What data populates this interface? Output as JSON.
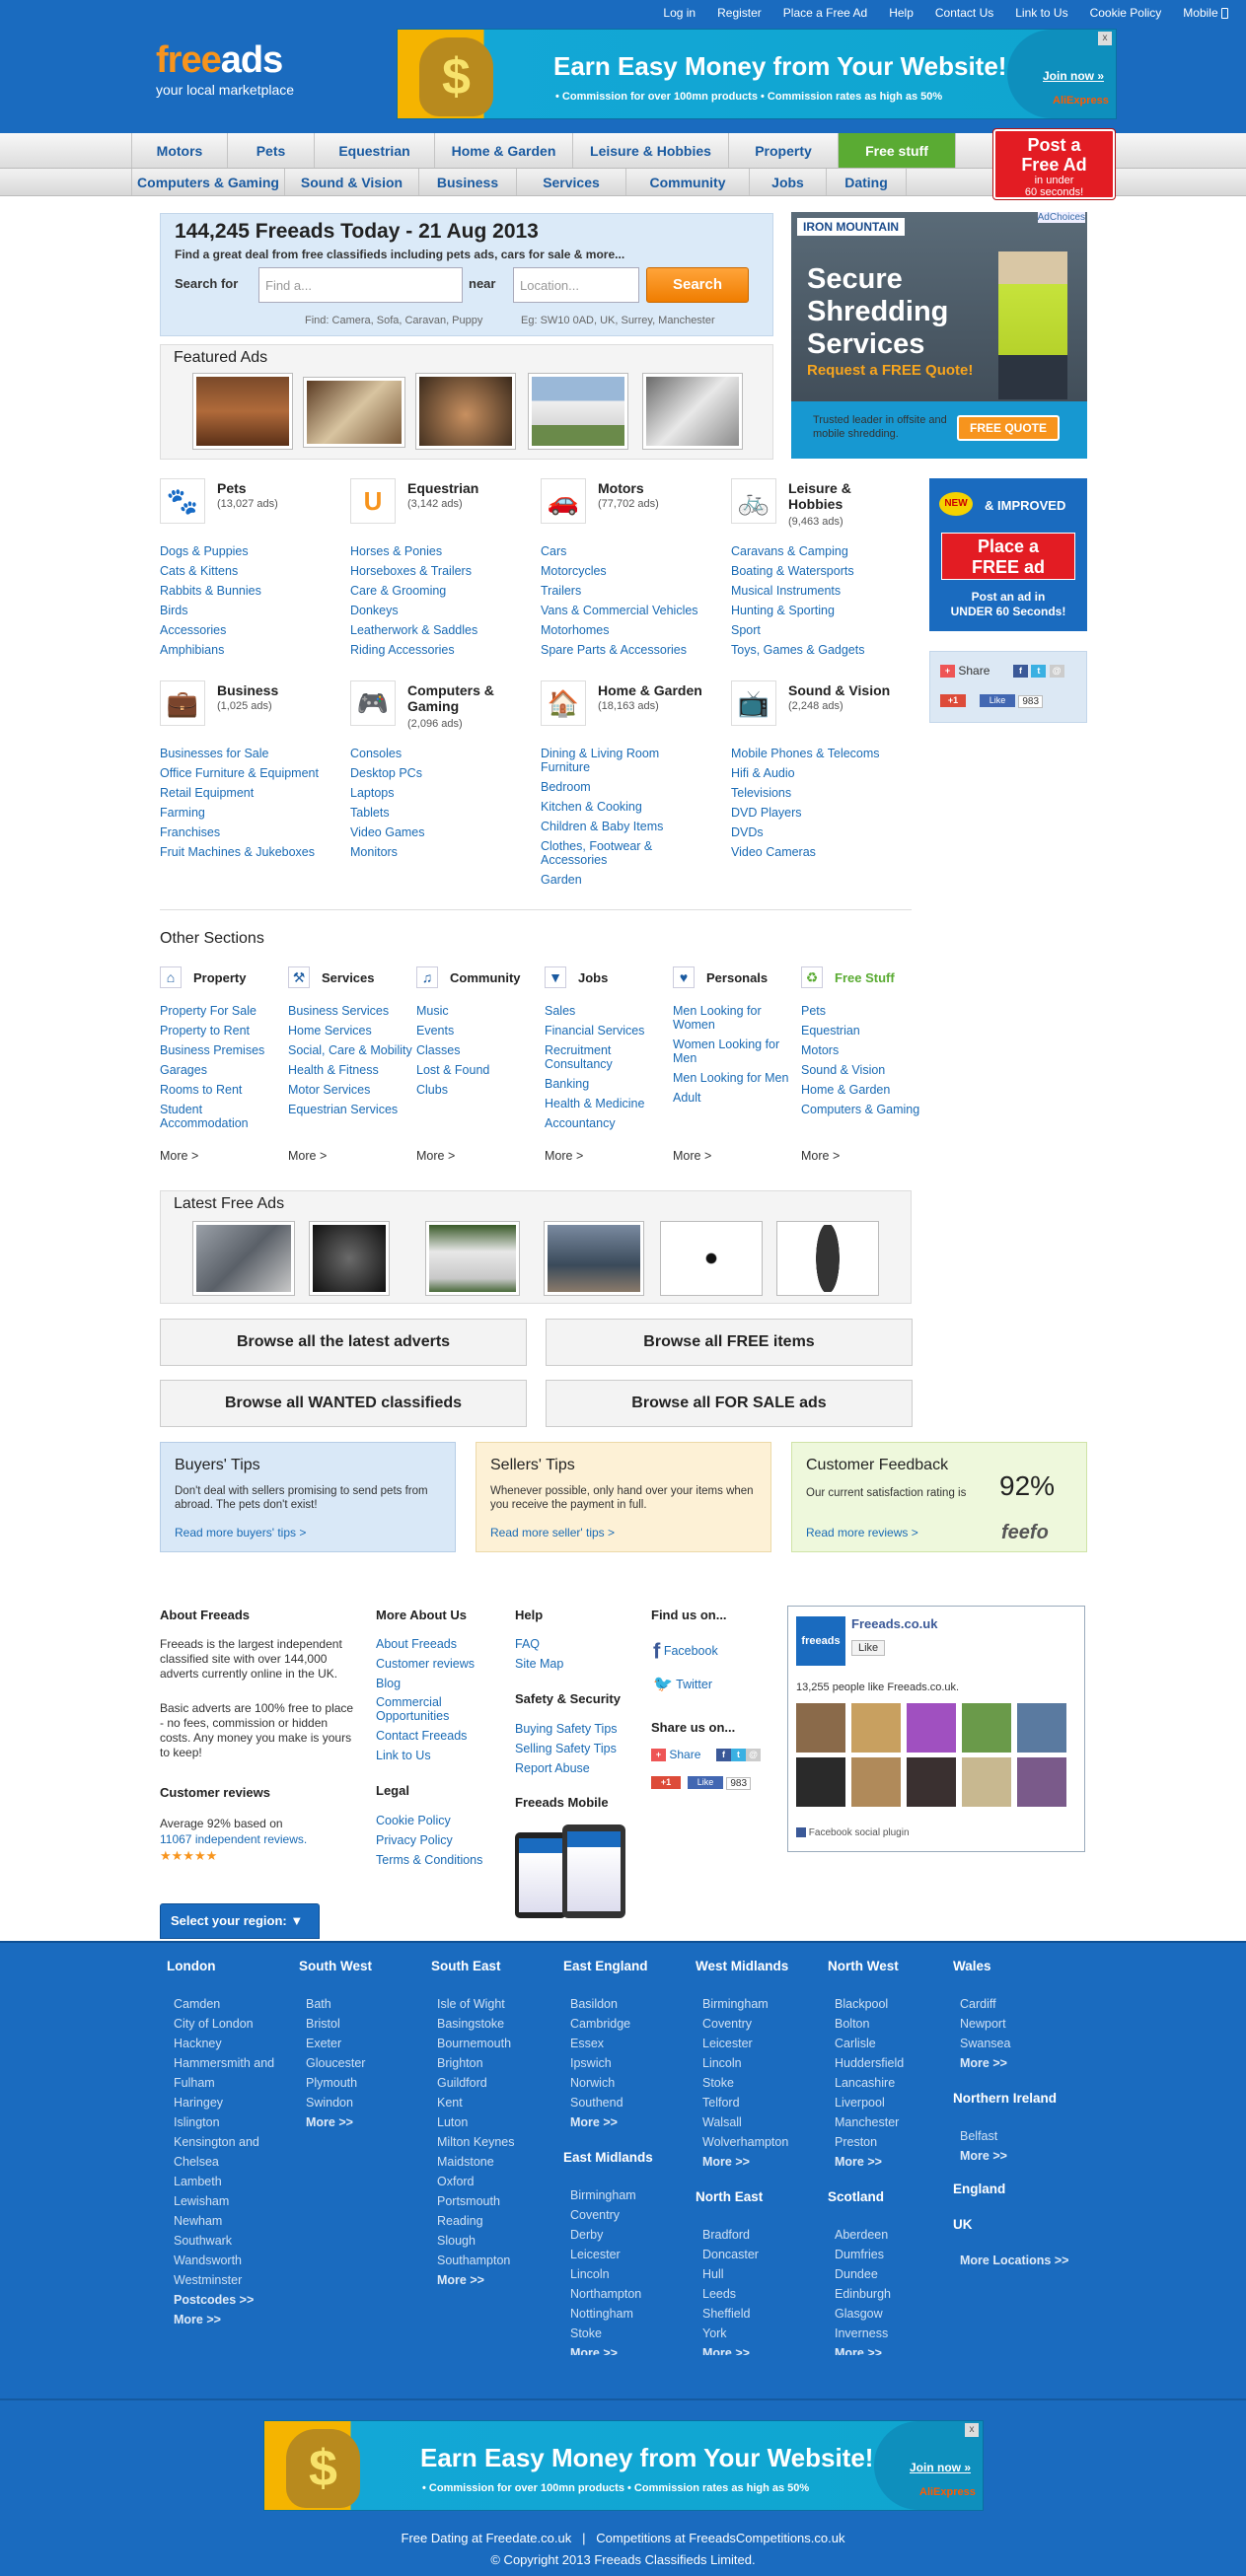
{
  "top_links": [
    "Log in",
    "Register",
    "Place a Free Ad",
    "Help",
    "Contact Us",
    "Link to Us",
    "Cookie Policy",
    "Mobile"
  ],
  "logo": {
    "part1": "free",
    "part2": "ads",
    "tagline": "your local marketplace"
  },
  "banner": {
    "title": "Earn Easy Money from Your Website!",
    "sub": "• Commission for over 100mn products • Commission rates as high as 50%",
    "join": "Join now »",
    "close": "x",
    "brand": "AliExpress"
  },
  "nav_primary": [
    "Motors",
    "Pets",
    "Equestrian",
    "Home & Garden",
    "Leisure & Hobbies",
    "Property",
    "Free stuff"
  ],
  "nav_secondary": [
    "Computers & Gaming",
    "Sound & Vision",
    "Business",
    "Services",
    "Community",
    "Jobs",
    "Dating"
  ],
  "post_ad": {
    "line1": "Post a",
    "line2": "Free Ad",
    "line3": "in under",
    "line4": "60 seconds!"
  },
  "search": {
    "title": "144,245 Freeads Today - 21 Aug 2013",
    "subtitle": "Find a great deal from free classifieds including pets ads, cars for sale & more...",
    "search_for": "Search for",
    "placeholder_what": "Find a...",
    "near": "near",
    "placeholder_where": "Location...",
    "button": "Search",
    "hint_find": "Find: Camera, Sofa, Caravan, Puppy",
    "hint_eg": "Eg: SW10 0AD, UK, Surrey, Manchester"
  },
  "featured": {
    "title": "Featured Ads"
  },
  "side_ad": {
    "brand": "IRON MOUNTAIN",
    "adchoices": "AdChoices",
    "headline1": "Secure",
    "headline2": "Shredding",
    "headline3": "Services",
    "cta": "Request a FREE Quote!",
    "footer": "Trusted leader in offsite and mobile shredding.",
    "button": "FREE QUOTE"
  },
  "categories": [
    {
      "title": "Pets",
      "count": "(13,027 ads)",
      "items": [
        "Dogs & Puppies",
        "Cats & Kittens",
        "Rabbits & Bunnies",
        "Birds",
        "Accessories",
        "Amphibians"
      ]
    },
    {
      "title": "Equestrian",
      "count": "(3,142 ads)",
      "items": [
        "Horses & Ponies",
        "Horseboxes & Trailers",
        "Care & Grooming",
        "Donkeys",
        "Leatherwork & Saddles",
        "Riding Accessories"
      ]
    },
    {
      "title": "Motors",
      "count": "(77,702 ads)",
      "items": [
        "Cars",
        "Motorcycles",
        "Trailers",
        "Vans & Commercial Vehicles",
        "Motorhomes",
        "Spare Parts & Accessories"
      ]
    },
    {
      "title": "Leisure & Hobbies",
      "count": "(9,463 ads)",
      "items": [
        "Caravans & Camping",
        "Boating & Watersports",
        "Musical Instruments",
        "Hunting & Sporting",
        "Sport",
        "Toys, Games & Gadgets"
      ]
    },
    {
      "title": "Business",
      "count": "(1,025 ads)",
      "items": [
        "Businesses for Sale",
        "Office Furniture & Equipment",
        "Retail Equipment",
        "Farming",
        "Franchises",
        "Fruit Machines & Jukeboxes"
      ]
    },
    {
      "title": "Computers & Gaming",
      "count": "(2,096 ads)",
      "items": [
        "Consoles",
        "Desktop PCs",
        "Laptops",
        "Tablets",
        "Video Games",
        "Monitors"
      ]
    },
    {
      "title": "Home & Garden",
      "count": "(18,163 ads)",
      "items": [
        "Dining & Living Room Furniture",
        "Bedroom",
        "Kitchen & Cooking",
        "Children & Baby Items",
        "Clothes, Footwear & Accessories",
        "Garden"
      ]
    },
    {
      "title": "Sound & Vision",
      "count": "(2,248 ads)",
      "items": [
        "Mobile Phones & Telecoms",
        "Hifi & Audio",
        "Televisions",
        "DVD Players",
        "DVDs",
        "Video Cameras"
      ]
    }
  ],
  "newbox": {
    "badge": "NEW",
    "improved": "& IMPROVED",
    "btn1": "Place a",
    "btn2": "FREE ad",
    "under1": "Post an ad in",
    "under2": "UNDER 60 Seconds!"
  },
  "share": {
    "label": "Share",
    "plus": "+1",
    "like": "Like",
    "count": "983"
  },
  "other_sections": {
    "title": "Other Sections",
    "more": "More >",
    "columns": [
      {
        "title": "Property",
        "items": [
          "Property For Sale",
          "Property to Rent",
          "Business Premises",
          "Garages",
          "Rooms to Rent",
          "Student Accommodation"
        ]
      },
      {
        "title": "Services",
        "items": [
          "Business Services",
          "Home Services",
          "Social, Care & Mobility",
          "Health & Fitness",
          "Motor Services",
          "Equestrian Services"
        ]
      },
      {
        "title": "Community",
        "items": [
          "Music",
          "Events",
          "Classes",
          "Lost & Found",
          "Clubs"
        ]
      },
      {
        "title": "Jobs",
        "items": [
          "Sales",
          "Financial Services",
          "Recruitment Consultancy",
          "Banking",
          "Health & Medicine",
          "Accountancy"
        ]
      },
      {
        "title": "Personals",
        "items": [
          "Men Looking for Women",
          "Women Looking for Men",
          "Men Looking for Men",
          "Adult"
        ]
      },
      {
        "title": "Free Stuff",
        "items": [
          "Pets",
          "Equestrian",
          "Motors",
          "Sound & Vision",
          "Home & Garden",
          "Computers & Gaming"
        ]
      }
    ]
  },
  "latest": {
    "title": "Latest Free Ads"
  },
  "browse": [
    "Browse all the latest adverts",
    "Browse all FREE items",
    "Browse all WANTED classifieds",
    "Browse all FOR SALE ads"
  ],
  "tips": {
    "buyers": {
      "title": "Buyers' Tips",
      "text": "Don't deal with sellers promising to send pets from abroad. The pets don't exist!",
      "link": "Read more buyers' tips >"
    },
    "sellers": {
      "title": "Sellers' Tips",
      "text": "Whenever possible, only hand over your items when you receive the payment in full.",
      "link": "Read more seller' tips >"
    },
    "feedback": {
      "title": "Customer Feedback",
      "text": "Our current satisfaction rating is",
      "rating": "92%",
      "link": "Read more reviews >",
      "brand": "feefo"
    }
  },
  "about": {
    "title": "About Freeads",
    "p1": "Freeads is the largest independent classified site with over 144,000 adverts currently online in the UK.",
    "p2": "Basic adverts are 100% free to place - no fees, commission or hidden costs. Any money you make is yours to keep!",
    "reviews_title": "Customer reviews",
    "reviews_text": "Average 92% based on",
    "reviews_link": "11067 independent reviews.",
    "stars": "★★★★★"
  },
  "more_about": {
    "title": "More About Us",
    "items": [
      "About Freeads",
      "Customer reviews",
      "Blog",
      "Commercial Opportunities",
      "Contact Freeads",
      "Link to Us"
    ]
  },
  "legal": {
    "title": "Legal",
    "items": [
      "Cookie Policy",
      "Privacy Policy",
      "Terms & Conditions"
    ]
  },
  "help": {
    "title": "Help",
    "items": [
      "FAQ",
      "Site Map"
    ]
  },
  "safety": {
    "title": "Safety & Security",
    "items": [
      "Buying Safety Tips",
      "Selling Safety Tips",
      "Report Abuse"
    ]
  },
  "mobile": {
    "title": "Freeads Mobile"
  },
  "find_us": {
    "title": "Find us on...",
    "facebook": "Facebook",
    "twitter": "Twitter"
  },
  "share_us": {
    "title": "Share us on...",
    "share": "Share",
    "plus": "+1",
    "like": "Like",
    "count": "983"
  },
  "fb_box": {
    "page": "Freeads.co.uk",
    "like": "Like",
    "people": "13,255 people like Freeads.co.uk.",
    "plugin": "Facebook social plugin",
    "logo": "freeads"
  },
  "region_select": "Select your region: ▼",
  "regions": [
    {
      "title": "London",
      "items": [
        "Camden",
        "City of London",
        "Hackney",
        "Hammersmith and Fulham",
        "Haringey",
        "Islington",
        "Kensington and Chelsea",
        "Lambeth",
        "Lewisham",
        "Newham",
        "Southwark",
        "Wandsworth",
        "Westminster"
      ],
      "extra": [
        "Postcodes >>",
        "More >>"
      ]
    },
    {
      "title": "South West",
      "items": [
        "Bath",
        "Bristol",
        "Exeter",
        "Gloucester",
        "Plymouth",
        "Swindon"
      ],
      "extra": [
        "More >>"
      ]
    },
    {
      "title": "South East",
      "items": [
        "Isle of Wight",
        "Basingstoke",
        "Bournemouth",
        "Brighton",
        "Guildford",
        "Kent",
        "Luton",
        "Milton Keynes",
        "Maidstone",
        "Oxford",
        "Portsmouth",
        "Reading",
        "Slough",
        "Southampton"
      ],
      "extra": [
        "More >>"
      ]
    },
    {
      "title": "East England",
      "items": [
        "Basildon",
        "Cambridge",
        "Essex",
        "Ipswich",
        "Norwich",
        "Southend"
      ],
      "extra": [
        "More >>"
      ]
    },
    {
      "title": "East Midlands",
      "items": [
        "Birmingham",
        "Coventry",
        "Derby",
        "Leicester",
        "Lincoln",
        "Northampton",
        "Nottingham",
        "Stoke"
      ],
      "extra": [
        "More >>"
      ]
    },
    {
      "title": "West Midlands",
      "items": [
        "Birmingham",
        "Coventry",
        "Leicester",
        "Lincoln",
        "Stoke",
        "Telford",
        "Walsall",
        "Wolverhampton"
      ],
      "extra": [
        "More >>"
      ]
    },
    {
      "title": "North East",
      "items": [
        "Bradford",
        "Doncaster",
        "Hull",
        "Leeds",
        "Sheffield",
        "York"
      ],
      "extra": [
        "More >>"
      ]
    },
    {
      "title": "North West",
      "items": [
        "Blackpool",
        "Bolton",
        "Carlisle",
        "Huddersfield",
        "Lancashire",
        "Liverpool",
        "Manchester",
        "Preston"
      ],
      "extra": [
        "More >>"
      ]
    },
    {
      "title": "Scotland",
      "items": [
        "Aberdeen",
        "Dumfries",
        "Dundee",
        "Edinburgh",
        "Glasgow",
        "Inverness"
      ],
      "extra": [
        "More >>"
      ]
    },
    {
      "title": "Wales",
      "items": [
        "Cardiff",
        "Newport",
        "Swansea"
      ],
      "extra": [
        "More >>"
      ]
    },
    {
      "title": "Northern Ireland",
      "items": [
        "Belfast"
      ],
      "extra": [
        "More >>"
      ]
    },
    {
      "title": "England",
      "items": [],
      "extra": []
    },
    {
      "title": "UK",
      "items": [],
      "extra": [
        "More Locations >>"
      ]
    }
  ],
  "footer": {
    "dating": "Free Dating at Freedate.co.uk",
    "sep": "|",
    "competitions": "Competitions at FreeadsCompetitions.co.uk",
    "copyright": "© Copyright 2013 Freeads Classifieds Limited."
  },
  "colors": {
    "brand_blue": "#1a6bbf",
    "accent_orange": "#f7941d",
    "post_red": "#e31c23",
    "free_green": "#5aab33"
  }
}
